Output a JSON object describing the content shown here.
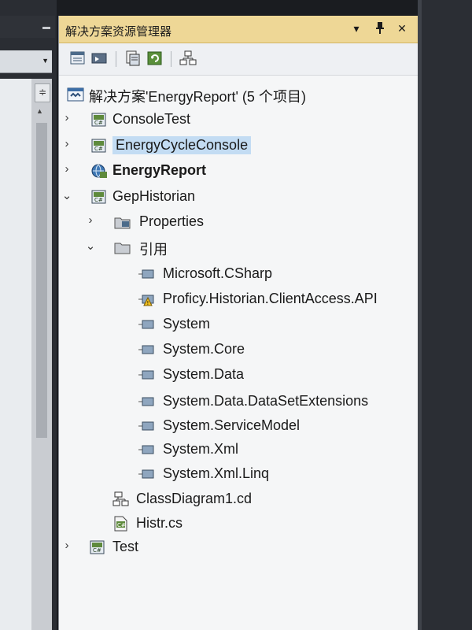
{
  "explorer": {
    "title": "解决方案资源管理器",
    "controls": {
      "dropdown": "▾",
      "pin": "⊣",
      "close": "✕"
    }
  },
  "toolbar": {
    "buttons": [
      "properties-icon",
      "show-all-files-icon",
      "view-code-icon",
      "refresh-icon",
      "class-diagram-icon"
    ]
  },
  "tree": {
    "solution": "解决方案'EnergyReport' (5 个项目)",
    "projects": [
      {
        "label": "ConsoleTest",
        "state": "collapsed"
      },
      {
        "label": "EnergyCycleConsole",
        "state": "collapsed",
        "selected": true
      },
      {
        "label": "EnergyReport",
        "state": "collapsed",
        "bold": true
      },
      {
        "label": "GepHistorian",
        "state": "expanded"
      }
    ],
    "gep_children": {
      "properties": "Properties",
      "references": "引用",
      "reference_items": [
        "Microsoft.CSharp",
        "Proficy.Historian.ClientAccess.API",
        "System",
        "System.Core",
        "System.Data",
        "System.Data.DataSetExtensions",
        "System.ServiceModel",
        "System.Xml",
        "System.Xml.Linq"
      ],
      "files": [
        "ClassDiagram1.cd",
        "Histr.cs"
      ]
    },
    "last_project": "Test"
  },
  "glyphs": {
    "collapsed": "›",
    "expanded": "⌄"
  },
  "colors": {
    "title_bar": "#eed796",
    "selection": "#c3dcf3",
    "panel_bg": "#f5f6f7"
  }
}
